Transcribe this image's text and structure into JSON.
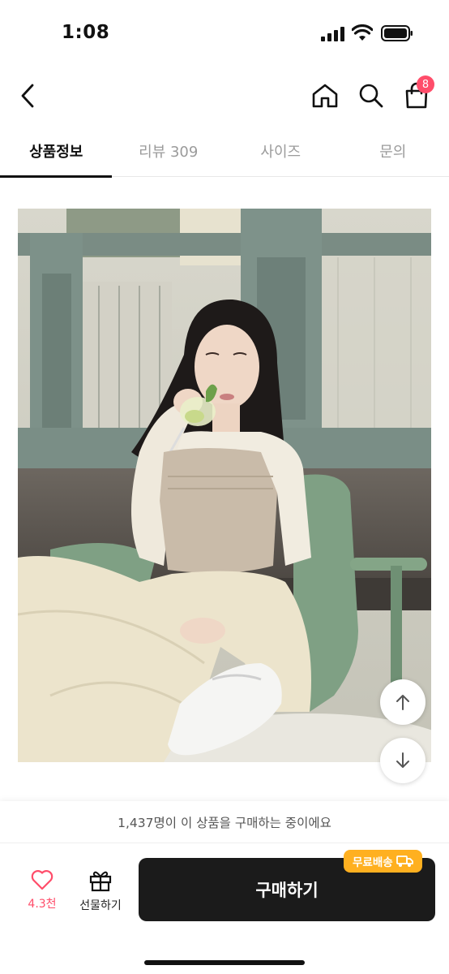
{
  "status": {
    "time": "1:08"
  },
  "header": {
    "cart_badge": "8"
  },
  "tabs": [
    {
      "label": "상품정보",
      "active": true
    },
    {
      "label": "리뷰 309",
      "active": false
    },
    {
      "label": "사이즈",
      "active": false
    },
    {
      "label": "문의",
      "active": false
    }
  ],
  "banner": {
    "text": "1,437명이 이 상품을 구매하는 중이에요"
  },
  "actions": {
    "like_count": "4.3천",
    "gift_label": "선물하기",
    "buy_label": "구매하기",
    "free_shipping": "무료배송"
  },
  "colors": {
    "accent": "#ff4d6a",
    "badge": "#ffb020",
    "buy_button": "#1b1b1b"
  }
}
